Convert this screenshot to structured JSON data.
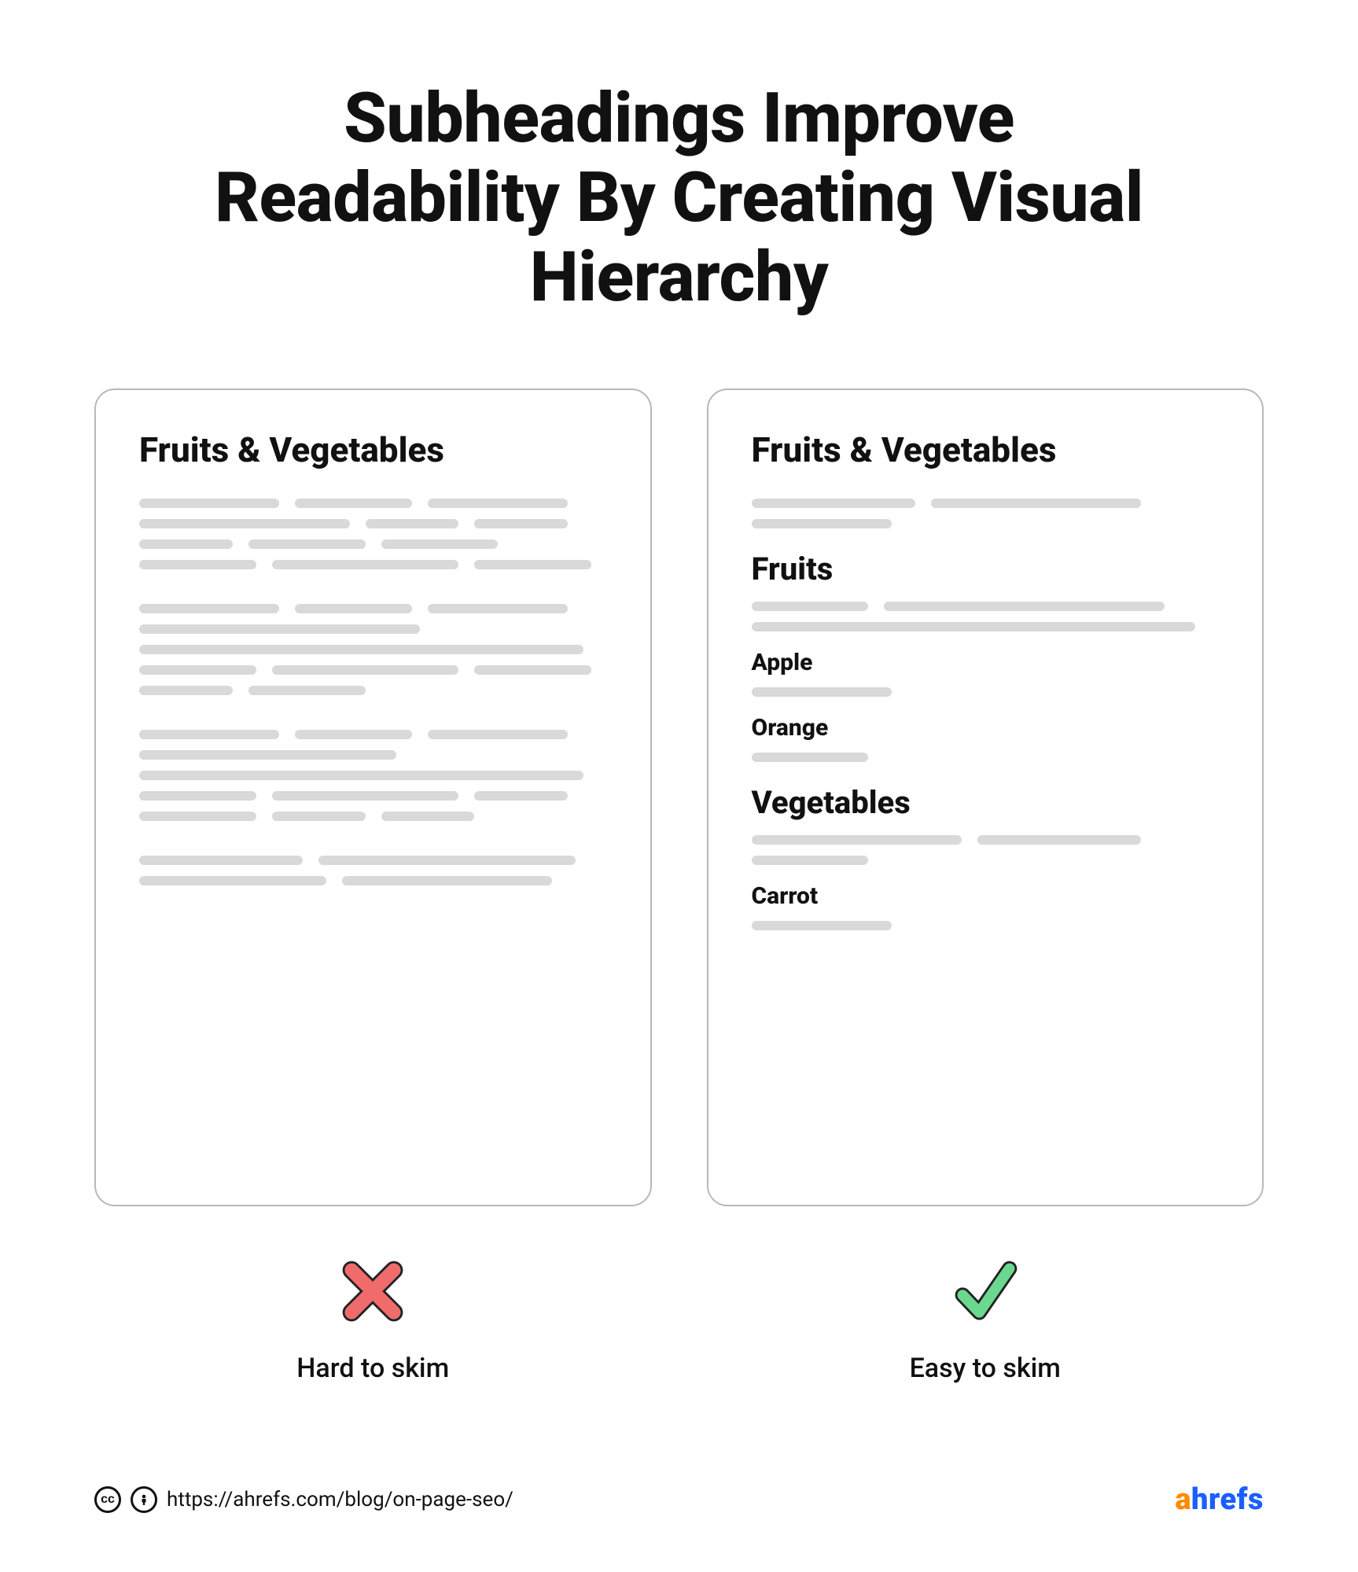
{
  "title": "Subheadings Improve Readability By Creating Visual Hierarchy",
  "left": {
    "heading": "Fruits & Vegetables",
    "verdict": "Hard to skim"
  },
  "right": {
    "heading": "Fruits & Vegetables",
    "sections": {
      "fruits": {
        "title": "Fruits",
        "items": {
          "apple": "Apple",
          "orange": "Orange"
        }
      },
      "vegetables": {
        "title": "Vegetables",
        "items": {
          "carrot": "Carrot"
        }
      }
    },
    "verdict": "Easy to skim"
  },
  "footer": {
    "url": "https://ahrefs.com/blog/on-page-seo/",
    "brand_a": "a",
    "brand_rest": "hrefs"
  }
}
